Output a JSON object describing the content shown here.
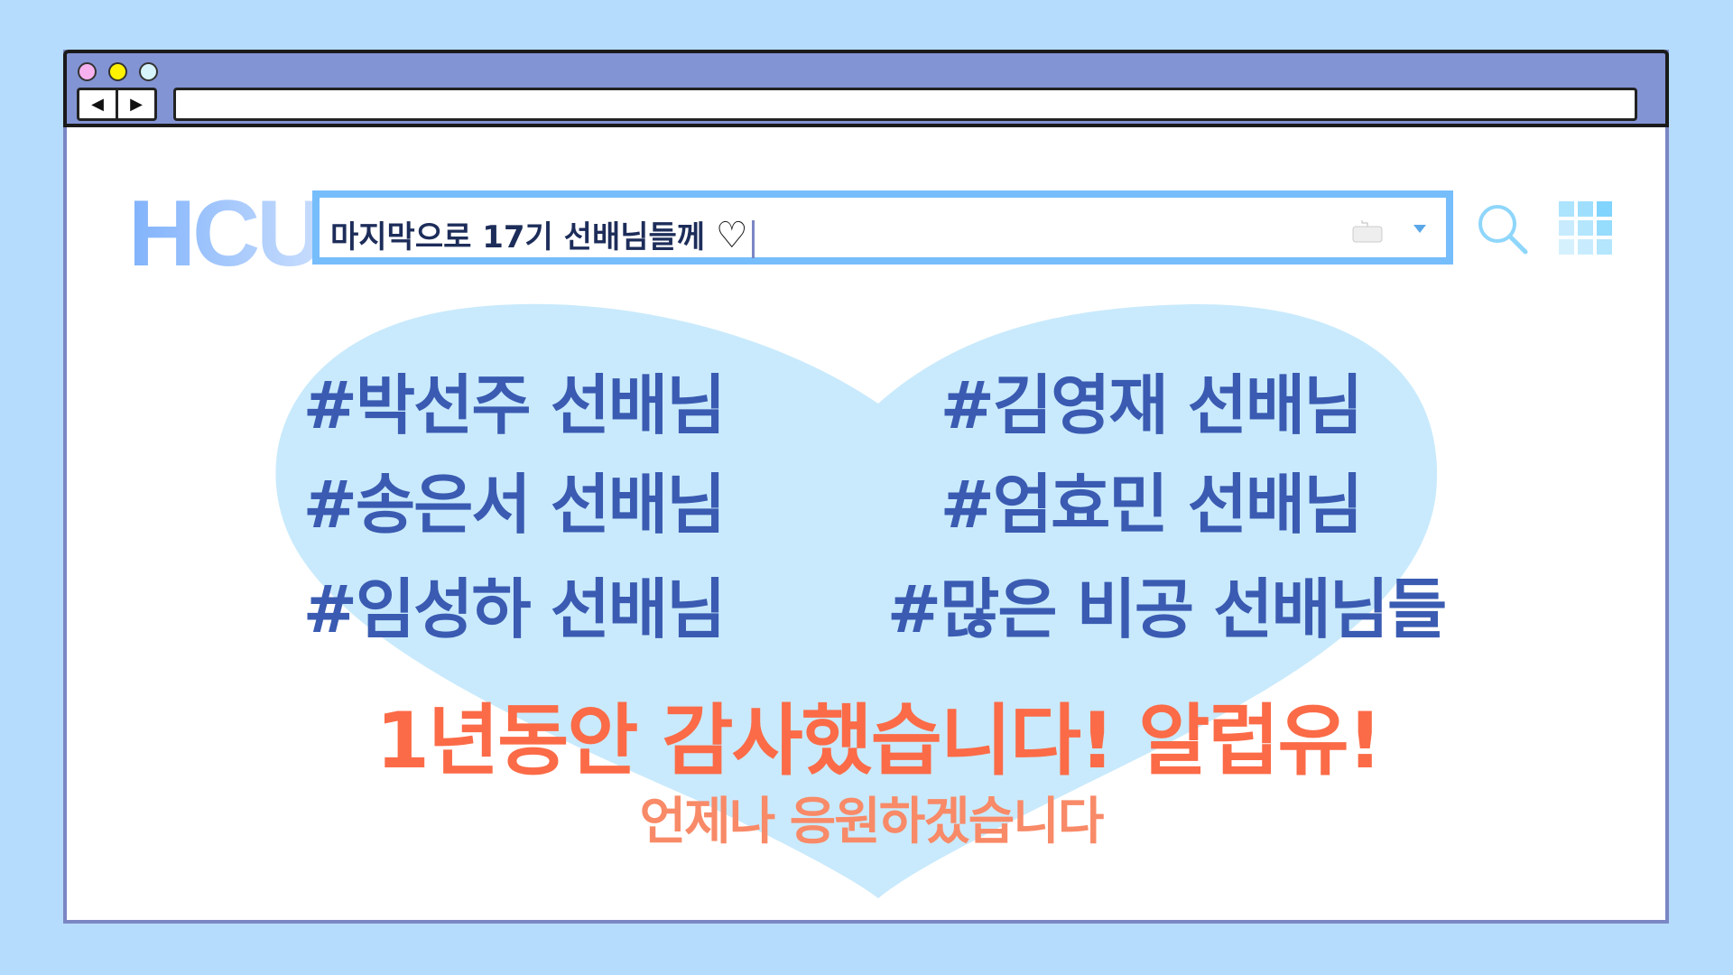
{
  "browser": {
    "back_icon": "◀",
    "forward_icon": "▶",
    "address": ""
  },
  "logo": "HCU",
  "search": {
    "query": "마지막으로 17기 선배님들께",
    "heart": "♡",
    "icons": [
      "keyboard-icon",
      "dropdown-icon",
      "search-icon",
      "apps-grid-icon"
    ]
  },
  "tags": {
    "left": [
      "#박선주 선배님",
      "#송은서 선배님",
      "#임성하 선배님"
    ],
    "right": [
      "#김영재 선배님",
      "#엄효민 선배님",
      "#많은 비공 선배님들"
    ]
  },
  "message": "1년동안 감사했습니다! 알럽유!",
  "submessage": "언제나 응원하겠습니다",
  "colors": {
    "background": "#b5dcfd",
    "titlebar": "#8394d4",
    "heart": "#c9eafc",
    "tags": "#3a5bb1",
    "message": "#fb6b47"
  }
}
